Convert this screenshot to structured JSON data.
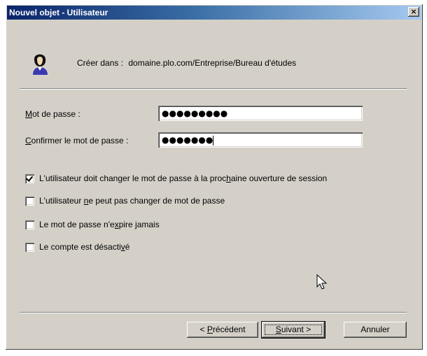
{
  "window": {
    "title": "Nouvel objet - Utilisateur",
    "close_label": "×"
  },
  "header": {
    "create_in_label": "Créer dans :",
    "create_in_path": "domaine.plo.com/Entreprise/Bureau d'études"
  },
  "form": {
    "password": {
      "label_first": "M",
      "label_rest": "ot de passe :",
      "masked_value": "●●●●●●●●●"
    },
    "confirm": {
      "label_first": "C",
      "label_rest": "onfirmer le mot de passe :",
      "masked_value": "●●●●●●●"
    }
  },
  "options": [
    {
      "pre": "L'utilisateur doit changer le mot de passe à la proc",
      "u": "h",
      "post": "aine ouverture de session",
      "checked": true
    },
    {
      "pre": "L'utilisateur ",
      "u": "n",
      "post": "e peut pas changer de mot de passe",
      "checked": false
    },
    {
      "pre": "Le mot de passe n'e",
      "u": "x",
      "post": "pire jamais",
      "checked": false
    },
    {
      "pre": "Le compte est désacti",
      "u": "v",
      "post": "é",
      "checked": false
    }
  ],
  "buttons": {
    "back": {
      "pre": "< ",
      "u": "P",
      "post": "récédent"
    },
    "next": {
      "pre": "",
      "u": "S",
      "post": "uivant >"
    },
    "cancel": {
      "label": "Annuler"
    }
  },
  "icons": {
    "user": "user-icon",
    "close": "close-icon",
    "cursor": "mouse-pointer-icon"
  }
}
